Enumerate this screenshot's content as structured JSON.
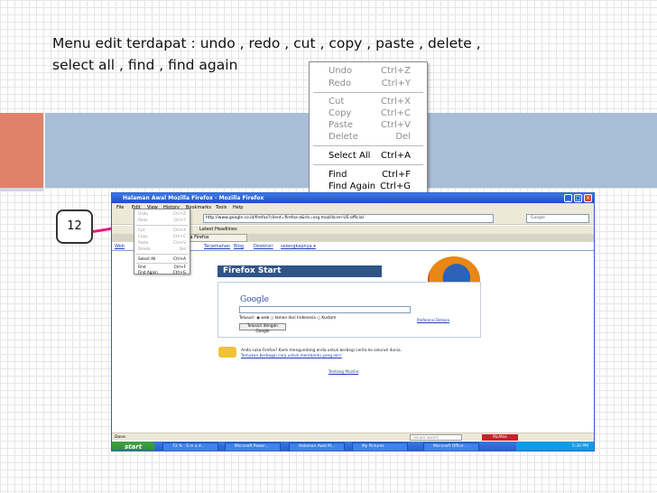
{
  "slide": {
    "title_line1": "Menu edit terdapat : undo , redo , cut , copy , paste , delete ,",
    "title_line2": "select all , find , find again",
    "badge": "12",
    "colors": {
      "orange": "#e0826a",
      "blue": "#a8bdd6",
      "arrow": "#e6197f"
    }
  },
  "edit_menu": {
    "items": [
      {
        "label": "Undo",
        "shortcut": "Ctrl+Z",
        "enabled": false
      },
      {
        "label": "Redo",
        "shortcut": "Ctrl+Y",
        "enabled": false
      },
      {
        "label": "Cut",
        "shortcut": "Ctrl+X",
        "enabled": false
      },
      {
        "label": "Copy",
        "shortcut": "Ctrl+C",
        "enabled": false
      },
      {
        "label": "Paste",
        "shortcut": "Ctrl+V",
        "enabled": false
      },
      {
        "label": "Delete",
        "shortcut": "Del",
        "enabled": false
      },
      {
        "label": "Select All",
        "shortcut": "Ctrl+A",
        "enabled": true
      },
      {
        "label": "Find",
        "shortcut": "Ctrl+F",
        "enabled": true
      },
      {
        "label": "Find Again",
        "shortcut": "Ctrl+G",
        "enabled": true
      }
    ]
  },
  "browser": {
    "window_title": "Halaman Awal Mozilla Firefox - Mozilla Firefox",
    "menubar": [
      "File",
      "Edit",
      "View",
      "History",
      "Bookmarks",
      "Tools",
      "Help"
    ],
    "address": "http://www.google.co.id/firefox?client=firefox-a&rls=org.mozilla:en-US:official",
    "search_placeholder": "Google",
    "bookmark_latest": "Latest Headlines",
    "tab_label": "Halaman Awal Mozilla Firefox",
    "links": [
      "Web",
      "Terjemahan",
      "Blog",
      "Direktori",
      "selengkapnya ▾"
    ],
    "firefox_start": "Firefox Start",
    "google_logo": "Google",
    "search_options": "Telusuri: ◉ web ○ laman dari Indonesia ○ Kustom",
    "search_button": "Telusuri dengan Google",
    "lang_link": "Preferensi Bahasa",
    "info_line1": "Anda suka Firefox? Kami mengundang anda untuk berbagi cerita ke seluruh dunia.",
    "info_line2": "Temukan berbagai cara untuk membantu yang lain!",
    "tentang": "Tentang Mozilla",
    "status_done": "Done",
    "security_search": "secure search",
    "mcafee": "McAfee",
    "start": "start",
    "taskbar_items": [
      "73 % - S m a d...",
      "Microsoft Power...",
      "Halaman Awal M...",
      "My Pictures",
      "Microsoft Office ..."
    ],
    "clock": "5:30 PM"
  }
}
